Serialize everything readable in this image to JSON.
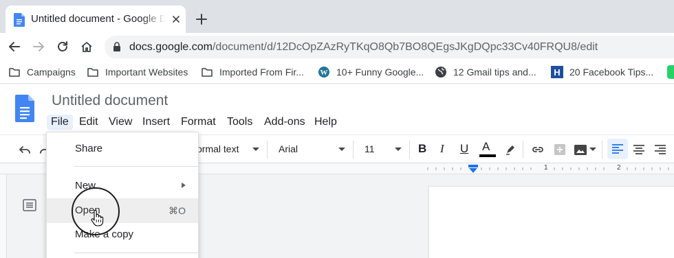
{
  "browser": {
    "tab": {
      "title": "Untitled document - Google Docs",
      "icon": "google-docs-icon"
    },
    "new_tab_label": "+",
    "nav": {
      "back_icon": "arrow-left-icon",
      "forward_icon": "arrow-right-icon",
      "reload_icon": "reload-icon",
      "home_icon": "home-icon"
    },
    "url": {
      "domain": "docs.google.com",
      "path": "/document/d/12DcOpZAzRyTKqO8Qb7BO8QEgsJKgDQpc33Cv40FRQU8/edit"
    }
  },
  "bookmarks": [
    {
      "label": "Campaigns",
      "icon": "folder-icon"
    },
    {
      "label": "Important Websites",
      "icon": "folder-icon"
    },
    {
      "label": "Imported From Fir...",
      "icon": "folder-icon"
    },
    {
      "label": "10+ Funny Google...",
      "icon": "wordpress-icon"
    },
    {
      "label": "12 Gmail tips and...",
      "icon": "globe-icon"
    },
    {
      "label": "20 Facebook Tips...",
      "icon": "h-logo-icon"
    }
  ],
  "docs": {
    "title": "Untitled document",
    "menu": [
      "File",
      "Edit",
      "View",
      "Insert",
      "Format",
      "Tools",
      "Add-ons",
      "Help"
    ],
    "active_menu": "File",
    "toolbar": {
      "style": "ormal text",
      "font": "Arial",
      "size": "11",
      "bold": "B",
      "italic": "I",
      "underline": "U",
      "text_color": "A"
    },
    "ruler_numbers": [
      "1",
      "2"
    ]
  },
  "file_menu": {
    "items": [
      {
        "label": "Share",
        "shortcut": "",
        "submenu": false
      },
      {
        "label": "New",
        "shortcut": "",
        "submenu": true
      },
      {
        "label": "Open",
        "shortcut": "⌘O",
        "submenu": false
      },
      {
        "label": "Make a copy",
        "shortcut": "",
        "submenu": false
      }
    ]
  },
  "colors": {
    "docs_blue": "#4285f4",
    "accent_blue": "#1a73e8",
    "tabstrip_bg": "#dee1e6",
    "menu_hover_bg": "#eeeeee"
  }
}
